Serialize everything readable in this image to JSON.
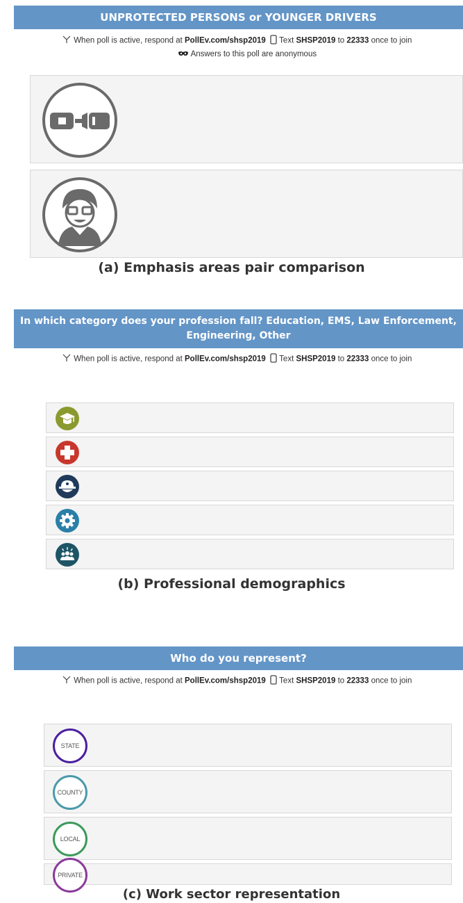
{
  "panel_a": {
    "banner": "UNPROTECTED PERSONS or YOUNGER DRIVERS",
    "instructions": {
      "prefix": "When poll is active, respond at",
      "url": "PollEv.com/shsp2019",
      "text_label": "Text",
      "code": "SHSP2019",
      "to": "to",
      "number": "22333",
      "suffix": "once to join"
    },
    "anonymous_note": "Answers to this poll are anonymous",
    "options": [
      {
        "icon": "seatbelt-icon"
      },
      {
        "icon": "young-driver-icon"
      }
    ],
    "caption": "(a) Emphasis areas pair comparison"
  },
  "panel_b": {
    "banner_line1": "In which category does your profession fall? Education, EMS, Law Enforcement,",
    "banner_line2": "Engineering, Other",
    "instructions": {
      "prefix": "When poll is active, respond at",
      "url": "PollEv.com/shsp2019",
      "text_label": "Text",
      "code": "SHSP2019",
      "to": "to",
      "number": "22333",
      "suffix": "once to join"
    },
    "options": [
      {
        "icon": "graduation-cap-icon",
        "color": "#8a9a2e"
      },
      {
        "icon": "medical-cross-icon",
        "color": "#c8372d"
      },
      {
        "icon": "police-hat-icon",
        "color": "#1f3a5a"
      },
      {
        "icon": "gear-icon",
        "color": "#2a7fa8"
      },
      {
        "icon": "group-icon",
        "color": "#1e5566"
      }
    ],
    "caption": "(b) Professional demographics"
  },
  "panel_c": {
    "banner": "Who do you represent?",
    "instructions": {
      "prefix": "When poll is active, respond at",
      "url": "PollEv.com/shsp2019",
      "text_label": "Text",
      "code": "SHSP2019",
      "to": "to",
      "number": "22333",
      "suffix": "once to join"
    },
    "options": [
      {
        "label": "STATE",
        "color": "#4b1fa0"
      },
      {
        "label": "COUNTY",
        "color": "#4a9aaa"
      },
      {
        "label": "LOCAL",
        "color": "#3c9a5a"
      },
      {
        "label": "PRIVATE",
        "color": "#8a3a9a"
      }
    ],
    "caption": "(c) Work sector representation"
  }
}
